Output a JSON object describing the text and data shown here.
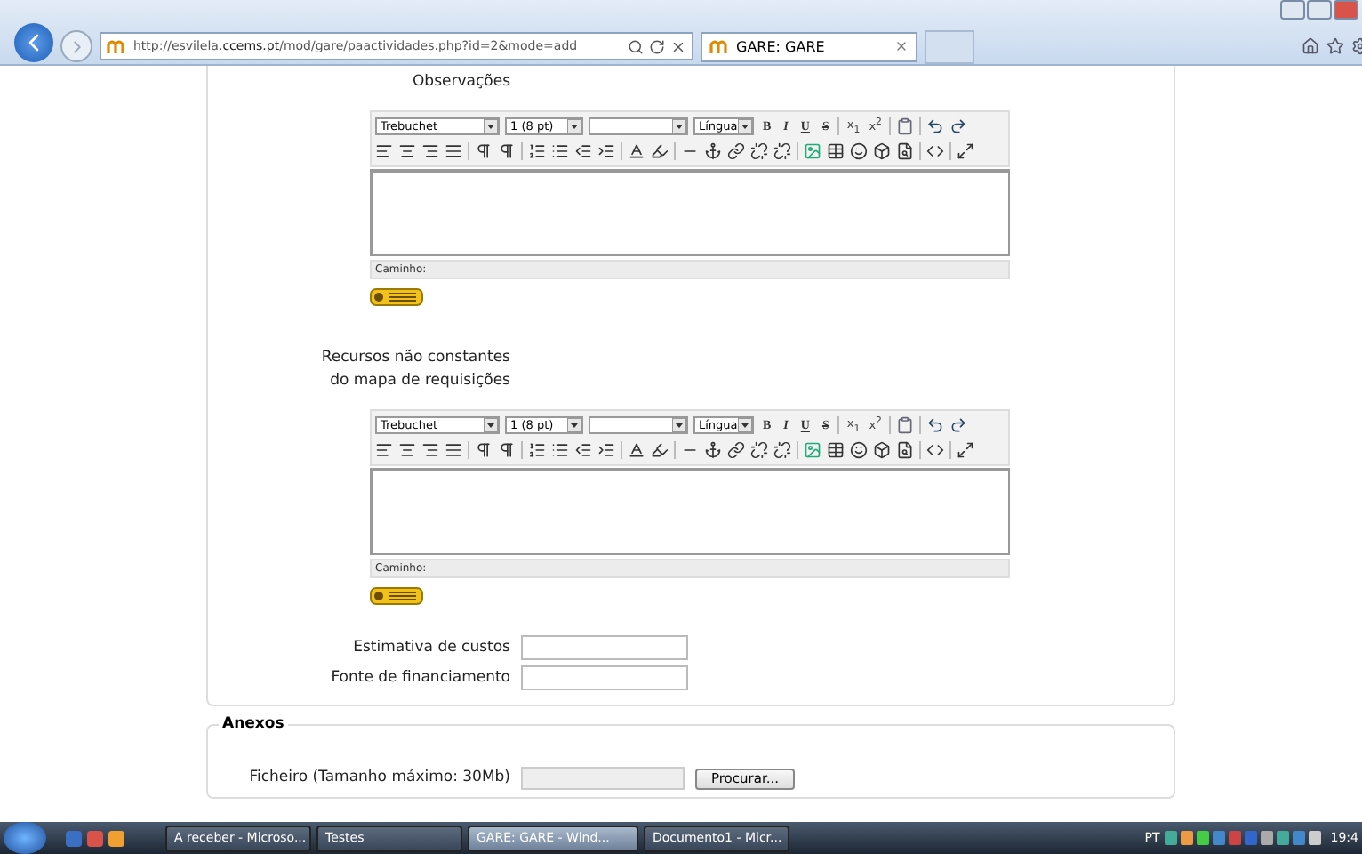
{
  "browser": {
    "url_prefix": "http://esvilela.",
    "url_domain": "ccems.pt",
    "url_path": "/mod/gare/paactividades.php?id=2&mode=add",
    "tabs": [
      {
        "title": "GARE: GARE",
        "selected": true
      }
    ]
  },
  "editors": [
    {
      "label_lines": [
        "Observações"
      ],
      "font": "Trebuchet",
      "size": "1 (8 pt)",
      "language": "Língua",
      "format_buttons": [
        "B",
        "I",
        "U",
        "S"
      ],
      "script_buttons": [
        "x$_{1}$",
        "x$^{2}$"
      ],
      "path_label": "Caminho:"
    },
    {
      "label_lines": [
        "Recursos não constantes",
        "do mapa de requisições"
      ],
      "font": "Trebuchet",
      "size": "1 (8 pt)",
      "language": "Língua",
      "format_buttons": [
        "B",
        "I",
        "U",
        "S"
      ],
      "script_buttons": [
        "x$_{1}$",
        "x$^{2}$"
      ],
      "path_label": "Caminho:"
    }
  ],
  "fields": [
    {
      "label": "Estimativa de custos"
    },
    {
      "label": "Fonte de financiamento"
    }
  ],
  "attachments": {
    "legend": "Anexos",
    "label": "Ficheiro (Tamanho máximo: 30Mb)",
    "button": "Procurar..."
  },
  "taskbar": {
    "items": [
      {
        "title": "A receber - Microso...",
        "selected": false
      },
      {
        "title": "Testes",
        "selected": false
      },
      {
        "title": "GARE: GARE - Wind...",
        "selected": true
      },
      {
        "title": "Documento1 - Micr...",
        "selected": false
      }
    ],
    "language": "PT",
    "clock": "19:4"
  }
}
